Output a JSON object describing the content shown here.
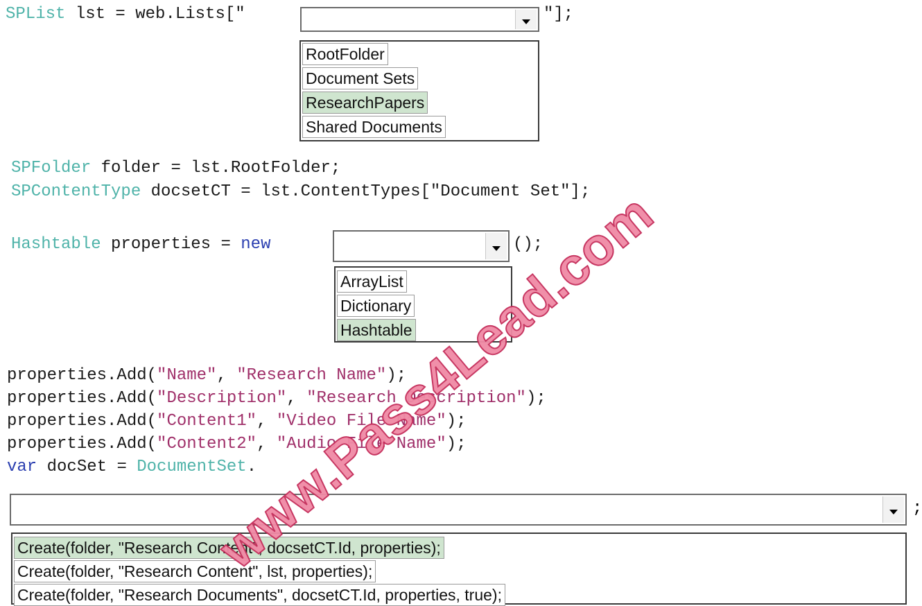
{
  "code": {
    "line1_type": "SPList",
    "line1_mid": " lst = web.Lists[\"",
    "line1_end": "\"];",
    "line2_type": "SPFolder",
    "line2_rest": " folder = lst.RootFolder;",
    "line3_type": "SPContentType",
    "line3_rest": " docsetCT = lst.ContentTypes[\"Document Set\"];",
    "line4_type": "Hashtable",
    "line4_mid": " properties = ",
    "line4_kw": "new",
    "line4_end": "();",
    "props": [
      {
        "pre": "properties.Add(",
        "a": "\"Name\"",
        "sep": ", ",
        "b": "\"Research Name\"",
        "post": ");"
      },
      {
        "pre": "properties.Add(",
        "a": "\"Description\"",
        "sep": ", ",
        "b": "\"Research Description\"",
        "post": ");"
      },
      {
        "pre": "properties.Add(",
        "a": "\"Content1\"",
        "sep": ", ",
        "b": "\"Video File Name\"",
        "post": ");"
      },
      {
        "pre": "properties.Add(",
        "a": "\"Content2\"",
        "sep": ", ",
        "b": "\"Audio File Name\"",
        "post": ");"
      }
    ],
    "line9_kw": "var",
    "line9_mid": " docSet = ",
    "line9_type": "DocumentSet",
    "line9_end": ".",
    "final_semi": ";"
  },
  "dropdown1": {
    "value": "",
    "options": [
      "RootFolder",
      "Document Sets",
      "ResearchPapers",
      "Shared Documents"
    ],
    "selected": "ResearchPapers"
  },
  "dropdown2": {
    "value": "",
    "options": [
      "ArrayList",
      "Dictionary",
      "Hashtable"
    ],
    "selected": "Hashtable"
  },
  "dropdown3": {
    "value": "",
    "options": [
      "Create(folder, \"Research Content\", docsetCT.Id, properties);",
      "Create(folder, \"Research Content\", lst, properties);",
      "Create(folder, \"Research Documents\", docsetCT.Id, properties, true);"
    ],
    "selected": "Create(folder, \"Research Content\", docsetCT.Id, properties);"
  },
  "watermark": "www.Pass4Lead.com",
  "colors": {
    "type": "#4fb3a9",
    "keyword": "#2b3fb0",
    "string": "#a0306a",
    "selected": "#cfe5cf",
    "watermark": "#f08aa5"
  },
  "icons": {
    "dropdown_arrow": "chevron-down-icon"
  }
}
